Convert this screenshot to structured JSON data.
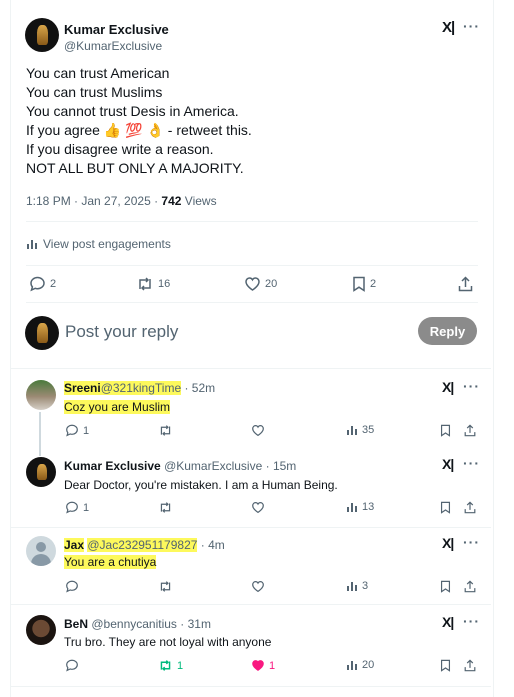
{
  "main_post": {
    "author_name": "Kumar Exclusive",
    "author_handle": "@KumarExclusive",
    "lines": [
      "You can trust American",
      "You can trust Muslims",
      "You cannot trust Desis in America.",
      "If you agree",
      "If you disagree write a reason.",
      "NOT ALL BUT ONLY A MAJORITY."
    ],
    "agree_emojis": "👍 💯 👌",
    "agree_suffix": "- retweet this.",
    "timestamp": "1:18 PM · Jan 27, 2025 · ",
    "views_count": "742",
    "views_label": " Views",
    "engagements_label": "View post engagements",
    "counts": {
      "replies": "2",
      "reposts": "16",
      "likes": "20",
      "bookmarks": "2"
    }
  },
  "composer": {
    "placeholder": "Post your reply",
    "button_label": "Reply"
  },
  "replies": [
    {
      "name": "Sreeni",
      "handle": "@321kingTime",
      "time": " · 52m",
      "text": "Coz you are Muslim",
      "counts": {
        "replies": "1",
        "reposts": "",
        "likes": "",
        "views": "35"
      }
    },
    {
      "name": "Kumar Exclusive",
      "handle": "@KumarExclusive",
      "time": " · 15m",
      "text": "Dear Doctor, you're mistaken. I am a Human Being.",
      "counts": {
        "replies": "1",
        "reposts": "",
        "likes": "",
        "views": "13"
      }
    },
    {
      "name": "Jax",
      "handle": "@Jac232951179827",
      "time": " · 4m",
      "text": "You are a chutiya",
      "counts": {
        "replies": "",
        "reposts": "",
        "likes": "",
        "views": "3"
      }
    },
    {
      "name": "BeN",
      "handle": "@bennycanitius",
      "time": " · 31m",
      "text": "Tru bro. They are not loyal with anyone",
      "counts": {
        "replies": "",
        "reposts": "1",
        "likes": "1",
        "views": "20"
      }
    }
  ],
  "colors": {
    "highlight": "#fdf95c",
    "repost_active": "#00ba7c",
    "like_active": "#f91880",
    "reply_button": "#8b8b8b"
  },
  "icons": [
    "x-logo-icon",
    "more-icon",
    "reply-icon",
    "repost-icon",
    "like-icon",
    "bookmark-icon",
    "share-icon",
    "views-icon",
    "engagements-icon"
  ]
}
